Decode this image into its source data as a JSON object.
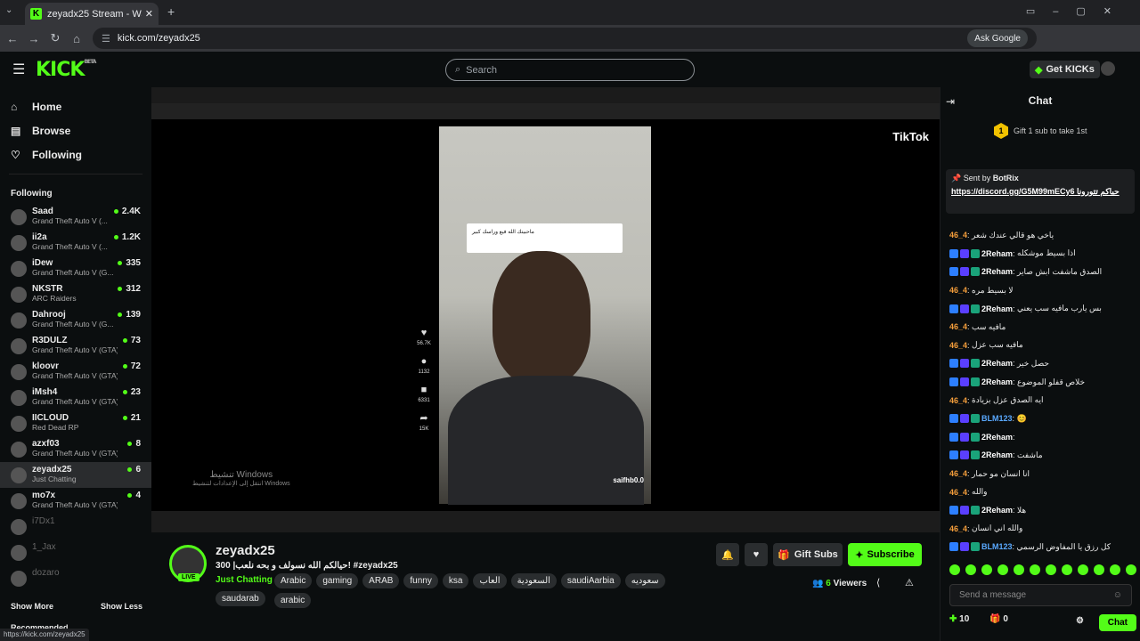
{
  "browser": {
    "tab_title": "zeyadx25 Stream - Watch Live o",
    "url": "kick.com/zeyadx25",
    "ask_google": "Ask Google",
    "status_url": "https://kick.com/zeyadx25"
  },
  "header": {
    "logo": "KICK",
    "logo_badge": "BETA",
    "search_placeholder": "Search",
    "get_kicks": "Get KICKs"
  },
  "sidebar": {
    "nav": [
      {
        "label": "Home"
      },
      {
        "label": "Browse"
      },
      {
        "label": "Following"
      }
    ],
    "section": "Following",
    "channels": [
      {
        "name": "Saad",
        "game": "Grand Theft Auto V (...",
        "viewers": "2.4K"
      },
      {
        "name": "ii2a",
        "game": "Grand Theft Auto V (...",
        "viewers": "1.2K"
      },
      {
        "name": "iDew",
        "game": "Grand Theft Auto V (G...",
        "viewers": "335"
      },
      {
        "name": "NKSTR",
        "game": "ARC Raiders",
        "viewers": "312"
      },
      {
        "name": "Dahrooj",
        "game": "Grand Theft Auto V (G...",
        "viewers": "139"
      },
      {
        "name": "R3DULZ",
        "game": "Grand Theft Auto V (GTA)",
        "viewers": "73"
      },
      {
        "name": "kloovr",
        "game": "Grand Theft Auto V (GTA)",
        "viewers": "72"
      },
      {
        "name": "iMsh4",
        "game": "Grand Theft Auto V (GTA)",
        "viewers": "23"
      },
      {
        "name": "IICLOUD",
        "game": "Red Dead RP",
        "viewers": "21"
      },
      {
        "name": "azxf03",
        "game": "Grand Theft Auto V (GTA)",
        "viewers": "8"
      },
      {
        "name": "zeyadx25",
        "game": "Just Chatting",
        "viewers": "6"
      },
      {
        "name": "mo7x",
        "game": "Grand Theft Auto V (GTA)",
        "viewers": "4"
      },
      {
        "name": "i7Dx1",
        "game": "",
        "viewers": ""
      },
      {
        "name": "1_Jax",
        "game": "",
        "viewers": ""
      },
      {
        "name": "dozaro",
        "game": "",
        "viewers": ""
      }
    ],
    "show_more": "Show More",
    "show_less": "Show Less",
    "recommended": "Recommended"
  },
  "video": {
    "tiktok": "TikTok",
    "comment": "ماحبيتك الله فيع وراسك كبير",
    "windows_activate": "تنشيط Windows",
    "windows_sub": "انتقل إلى الإعدادات لتنشيط Windows",
    "overlay_user": "saifhb0.0",
    "likes": "56.7K",
    "comments": "1132",
    "saves": "6331",
    "shares": "15K"
  },
  "stream": {
    "name": "zeyadx25",
    "live": "LIVE",
    "title": "حيالكم الله نسولف و بحه نلعب| 300! #zeyadx25",
    "category": "Just Chatting",
    "tags": [
      "Arabic",
      "gaming",
      "ARAB",
      "funny",
      "ksa",
      "العاب",
      "السعودية",
      "saudiAarbia",
      "سعوديه",
      "arabic"
    ],
    "tag_last": "saudarab",
    "gift_subs": "Gift Subs",
    "subscribe": "Subscribe",
    "viewers_count": "6",
    "viewers_label": "Viewers"
  },
  "chat": {
    "title": "Chat",
    "gift_text": "Gift 1 sub to take 1st",
    "gift_badge": "1",
    "pinned": {
      "sent_by": "Sent by",
      "sender": "BotRix",
      "link": "https://discord.gg/G5M99mECy6",
      "text": "حياكم تتورونا"
    },
    "messages": [
      {
        "user": "46_4",
        "color": "u1",
        "text": "ياخي هو قالي عندك شعر"
      },
      {
        "user": "2Reham",
        "color": "u2",
        "text": "اذا بسيط موشكله"
      },
      {
        "user": "2Reham",
        "color": "u2",
        "text": "الصدق ماشفت ابش صاير"
      },
      {
        "user": "46_4",
        "color": "u1",
        "text": "لا بسيط مره"
      },
      {
        "user": "2Reham",
        "color": "u2",
        "text": "بس يارب مافيه سب يعني"
      },
      {
        "user": "46_4",
        "color": "u1",
        "text": "مافيه سب"
      },
      {
        "user": "46_4",
        "color": "u1",
        "text": "مافيه سب عزل"
      },
      {
        "user": "2Reham",
        "color": "u2",
        "text": "حصل خير"
      },
      {
        "user": "2Reham",
        "color": "u2",
        "text": "خلاص قفلو الموضوع"
      },
      {
        "user": "46_4",
        "color": "u1",
        "text": "ايه الصدق عزل بزيادة"
      },
      {
        "user": "BLM123",
        "color": "u3",
        "text": "😊"
      },
      {
        "user": "2Reham",
        "color": "u2",
        "text": ""
      },
      {
        "user": "2Reham",
        "color": "u2",
        "text": "ماشفت"
      },
      {
        "user": "46_4",
        "color": "u1",
        "text": "انا انسان مو حمار"
      },
      {
        "user": "46_4",
        "color": "u1",
        "text": "والله"
      },
      {
        "user": "2Reham",
        "color": "u2",
        "text": "هلا"
      },
      {
        "user": "46_4",
        "color": "u1",
        "text": "والله اني انسان"
      },
      {
        "user": "BLM123",
        "color": "u3",
        "text": "كل رزق يا المفاوض الرسمي"
      }
    ],
    "send_placeholder": "Send a message",
    "points": "10",
    "gifts": "0",
    "chat_button": "Chat"
  }
}
